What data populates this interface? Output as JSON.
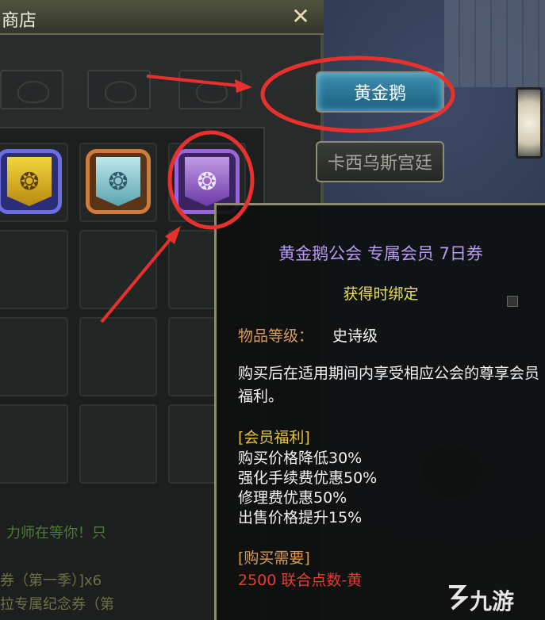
{
  "shop": {
    "title": "商店",
    "close_icon": "close-x-icon"
  },
  "guild_buttons": [
    {
      "label": "黄金鹅",
      "active": true
    },
    {
      "label": "卡西乌斯宫廷",
      "active": false
    }
  ],
  "items": [
    {
      "icon": "guild-gold-badge-icon",
      "color": "#f3d53c"
    },
    {
      "icon": "guild-cyan-badge-icon",
      "color": "#bfe6ec"
    },
    {
      "icon": "guild-purple-badge-icon",
      "color": "#c39ae6"
    }
  ],
  "tooltip": {
    "name": "黄金鹅公会 专属会员 7日券",
    "bind": "获得时绑定",
    "grade_label": "物品等级：",
    "grade_value": "史诗级",
    "description": "购买后在适用期间内享受相应公会的尊享会员福利。",
    "benefit_title": "[会员福利]",
    "benefits": [
      "购买价格降低30%",
      "强化手续费优惠50%",
      "修理费优惠50%",
      "出售价格提升15%"
    ],
    "requirement_title": "[购买需要]",
    "requirement": "2500 联合点数-黄"
  },
  "background_text": {
    "left_line1": "力师在等你！只",
    "left_line2": "券（第一季）]x6",
    "left_line3": "拉专属纪念券（第"
  },
  "watermark": "九游",
  "colors": {
    "active_button": "#1a5e7e",
    "item_name": "#b89af2",
    "bind_text": "#e9e24a",
    "requirement": "#ea3b2e",
    "annotation_red": "#e8312d"
  }
}
